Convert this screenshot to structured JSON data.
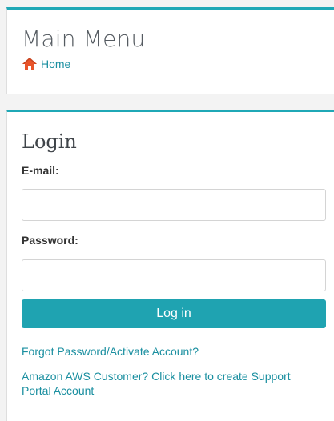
{
  "menu": {
    "title": "Main Menu",
    "breadcrumb_home": "Home"
  },
  "login": {
    "title": "Login",
    "email_label": "E-mail:",
    "email_value": "",
    "email_placeholder": "",
    "password_label": "Password:",
    "password_value": "",
    "password_placeholder": "",
    "submit_label": "Log in",
    "forgot_link": "Forgot Password/Activate Account?",
    "aws_link": "Amazon AWS Customer?  Click here to create Support Portal Account"
  },
  "colors": {
    "accent": "#1fa8b6",
    "button": "#1fa3b1",
    "link": "#1a8fa0",
    "home_icon": "#e8542a"
  },
  "icons": {
    "home": "home-icon"
  }
}
